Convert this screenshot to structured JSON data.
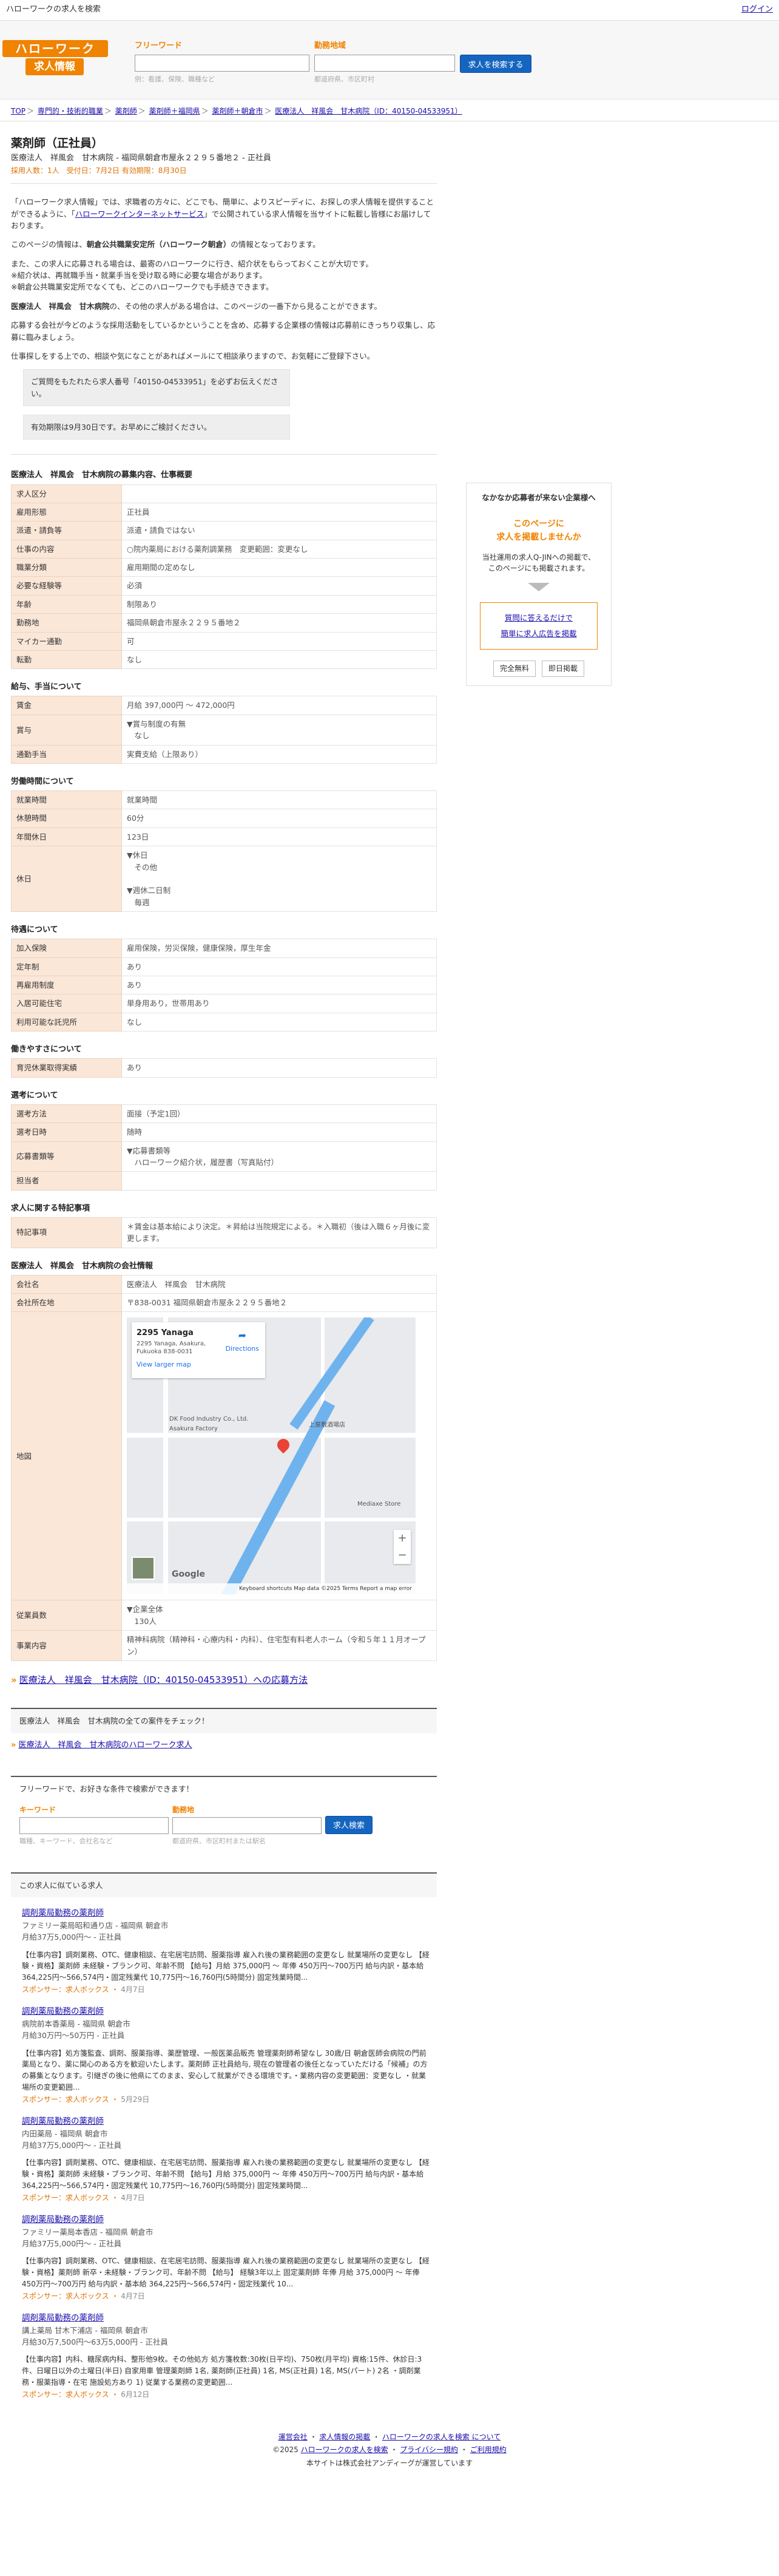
{
  "topbar": {
    "left": "ハローワークの求人を検索",
    "right": "ログイン"
  },
  "logo": {
    "line1": "ハローワーク",
    "line2": "求人情報"
  },
  "search": {
    "keyword_label": "フリーワード",
    "keyword_hint": "例：看護、保険、職種など",
    "area_label": "勤務地域",
    "area_hint": "都道府県、市区町村",
    "button": "求人を検索する"
  },
  "breadcrumb": [
    "TOP",
    "専門的・技術的職業",
    "薬剤師",
    "薬剤師＋福岡県",
    "薬剤師＋朝倉市",
    "医療法人　祥風会　甘木病院（ID：40150-04533951）"
  ],
  "job": {
    "title": "薬剤師（正社員）",
    "sub1": "医療法人　祥風会　甘木病院 - 福岡県朝倉市屋永２２９５番地２ - 正社員",
    "sub2": "採用人数：1人　受付日：7月2日  有効期限：8月30日"
  },
  "intro": {
    "p1a": "「ハローワーク求人情報」では、求職者の方々に、",
    "p1b": "どこでも、簡単に、よりスピーディに、お探しの求人情報を提供することができるように、「",
    "p1link": "ハローワークインターネットサービス",
    "p1c": "」で公開されている求人情報を当サイトに転載し皆様にお届けしております。",
    "p2a": "このページの情報は、",
    "p2b": "朝倉公共職業安定所（ハローワーク朝倉）",
    "p2c": "の情報となっております。",
    "p3": "また、この求人に応募される場合は、最寄のハローワークに行き、紹介状をもらっておくことが大切です。",
    "p4": "※紹介状は、再就職手当・就業手当を受け取る時に必要な場合があります。",
    "p5": "※朝倉公共職業安定所でなくても、どこのハローワークでも手続きできます。",
    "p6a": "医療法人　祥風会　甘木病院",
    "p6b": "の、その他の求人がある場合は、このページの一番下から見ることができます。",
    "p7": "応募する会社が今どのような採用活動をしているかということを含め、応募する企業様の情報は応募前にきっちり収集し、応募に臨みましょう。",
    "p8": "仕事探しをする上での、相談や気になことがあればメールにて相談承りますので、お気軽にご登録下さい。",
    "note1": "ご質問をもたれたら求人番号「40150-04533951」を必ずお伝えください。",
    "note2": "有効期限は9月30日です。お早めにご検討ください。"
  },
  "side": {
    "h": "なかなか応募者が来ない企業様へ",
    "o1": "このページに",
    "o2": "求人を掲載しませんか",
    "t1": "当社運用の求人Q-JINへの掲載で、",
    "t2": "このページにも掲載されます。",
    "b1": "質問に答えるだけで",
    "b2": "簡単に求人広告を掲載",
    "btn1": "完全無料",
    "btn2": "即日掲載"
  },
  "sections": {
    "main_title": "医療法人　祥風会　甘木病院の募集内容、仕事概要",
    "main_rows": [
      [
        "求人区分",
        ""
      ],
      [
        "雇用形態",
        "正社員"
      ],
      [
        "派遣・請負等",
        "派遣・請負ではない"
      ],
      [
        "仕事の内容",
        "○院内薬局における薬剤調業務　変更範囲：変更なし"
      ],
      [
        "職業分類",
        "雇用期間の定めなし"
      ],
      [
        "必要な経験等",
        "必須"
      ],
      [
        "年齢",
        "制限あり"
      ],
      [
        "勤務地",
        "福岡県朝倉市屋永２２９５番地２"
      ],
      [
        "マイカー通勤",
        "可"
      ],
      [
        "転勤",
        "なし"
      ]
    ],
    "pay_title": "給与、手当について",
    "pay_rows": [
      [
        "賃金",
        "月給 397,000円 〜 472,000円"
      ],
      [
        "賞与",
        "▼賞与制度の有無\n　なし"
      ],
      [
        "通勤手当",
        "実費支給（上限あり）"
      ]
    ],
    "time_title": "労働時間について",
    "time_rows": [
      [
        "就業時間",
        "就業時間"
      ],
      [
        "休憩時間",
        "60分"
      ],
      [
        "年間休日",
        "123日"
      ],
      [
        "休日",
        "▼休日\n　その他\n\n▼週休二日制\n　毎週"
      ]
    ],
    "welfare_title": "待遇について",
    "welfare_rows": [
      [
        "加入保険",
        "雇用保険，労災保険，健康保険，厚生年金"
      ],
      [
        "定年制",
        "あり"
      ],
      [
        "再雇用制度",
        "あり"
      ],
      [
        "入居可能住宅",
        "単身用あり，世帯用あり"
      ],
      [
        "利用可能な託児所",
        "なし"
      ]
    ],
    "ease_title": "働きやすさについて",
    "ease_rows": [
      [
        "育児休業取得実績",
        "あり"
      ]
    ],
    "apply_title": "選考について",
    "apply_rows": [
      [
        "選考方法",
        "面接（予定1回）"
      ],
      [
        "選考日時",
        "随時"
      ],
      [
        "応募書類等",
        "▼応募書類等\n　ハローワーク紹介状，履歴書（写真貼付）"
      ],
      [
        "担当者",
        ""
      ]
    ],
    "special_title": "求人に関する特記事項",
    "special_rows": [
      [
        "特記事項",
        "＊賃金は基本給により決定。＊昇給は当院規定による。＊入職初（後は入職６ヶ月後に変更します。"
      ]
    ],
    "company_title": "医療法人　祥風会　甘木病院の会社情報",
    "company_rows": [
      [
        "会社名",
        "医療法人　祥風会　甘木病院"
      ],
      [
        "会社所在地",
        "〒838-0031 福岡県朝倉市屋永２２９５番地２"
      ]
    ],
    "map_label": "地図",
    "company_rows2": [
      [
        "従業員数",
        "▼企業全体\n　130人"
      ],
      [
        "事業内容",
        "精神科病院（精神科・心療内科・内科）、住宅型有料老人ホーム（令和５年１１月オープン）"
      ]
    ]
  },
  "map": {
    "title": "2295 Yanaga",
    "addr": "2295 Yanaga, Asakura, Fukuoka 838-0031",
    "view": "View larger map",
    "dir": "Directions",
    "place1": "DK Food Industry Co., Ltd. Asakura Factory",
    "place2": "上屋敷酒場店",
    "place3": "Mediaxe Store",
    "footer": "Keyboard shortcuts   Map data ©2025   Terms   Report a map error",
    "google": "Google"
  },
  "applylink": "医療法人　祥風会　甘木病院（ID：40150-04533951）への応募方法",
  "allblock": {
    "t": "医療法人　祥風会　甘木病院の全ての案件をチェック！",
    "link": "医療法人　祥風会　甘木病院のハローワーク求人"
  },
  "freesearch": {
    "t": "フリーワードで、お好きな条件で検索ができます！",
    "kw": "キーワード",
    "kwh": "職種、キーワード、会社名など",
    "ar": "勤務地",
    "arh": "都道府県、市区町村または駅名",
    "btn": "求人検索"
  },
  "related_title": "この求人に似ている求人",
  "related": [
    {
      "t": "調剤薬局勤務の薬剤師",
      "m1": "ファミリー薬局昭和通り店 - 福岡県 朝倉市",
      "m2": "月給37万5,000円〜 - 正社員",
      "d": "【仕事内容】調剤業務、OTC、健康相談、在宅居宅訪問、服薬指導 雇入れ後の業務範囲の変更なし 就業場所の変更なし 【経験・資格】薬剤師 未経験・ブランク可、年齢不問 【給与】月給 375,000円 〜 年俸 450万円〜700万円 給与内訳・基本給 364,225円〜566,574円・固定残業代 10,775円〜16,760円(5時間分) 固定残業時間...",
      "sp": "スポンサー：求人ボックス",
      "date": "4月7日"
    },
    {
      "t": "調剤薬局勤務の薬剤師",
      "m1": "病院前本香薬局 - 福岡県 朝倉市",
      "m2": "月給30万円〜50万円 - 正社員",
      "d": "【仕事内容】処方箋監査、調剤、服薬指導、薬歴管理、一般医薬品販売 管理薬剤師希望なし 30歳/日 朝倉医師会病院の門前薬局となり、薬に関心のある方を歓迎いたします。薬剤師 正社員給与, 現在の管理者の後任となっていただける「候補」の方の募集となります。引継ぎの後に他県にてのまま、安心して就業ができる環境です。・業務内容の変更範囲：変更なし ・就業場所の変更範囲...",
      "sp": "スポンサー：求人ボックス",
      "date": "5月29日"
    },
    {
      "t": "調剤薬局勤務の薬剤師",
      "m1": "内田薬局 - 福岡県 朝倉市",
      "m2": "月給37万5,000円〜 - 正社員",
      "d": "【仕事内容】調剤業務、OTC、健康相談、在宅居宅訪問、服薬指導 雇入れ後の業務範囲の変更なし 就業場所の変更なし 【経験・資格】薬剤師 未経験・ブランク可、年齢不問 【給与】月給 375,000円 〜 年俸 450万円〜700万円 給与内訳・基本給 364,225円〜566,574円・固定残業代 10,775円〜16,760円(5時間分) 固定残業時間...",
      "sp": "スポンサー：求人ボックス",
      "date": "4月7日"
    },
    {
      "t": "調剤薬局勤務の薬剤師",
      "m1": "ファミリー薬局本香店 - 福岡県 朝倉市",
      "m2": "月給37万5,000円〜 - 正社員",
      "d": "【仕事内容】調剤業務、OTC、健康相談、在宅居宅訪問、服薬指導 雇入れ後の業務範囲の変更なし 就業場所の変更なし 【経験・資格】薬剤師 新卒・未経験・ブランク可、年齢不問 【給与】 経験3年以上 固定薬剤師 年俸 月給 375,000円 〜 年俸 450万円〜700万円 給与内訳・基本給 364,225円〜566,574円・固定残業代 10...",
      "sp": "スポンサー：求人ボックス",
      "date": "4月7日"
    },
    {
      "t": "調剤薬局勤務の薬剤師",
      "m1": "講上薬局 甘木下浦店 - 福岡県 朝倉市",
      "m2": "月給30万7,500円〜63万5,000円 - 正社員",
      "d": "【仕事内容】内科、糖尿病内科、整形他9枚。その他処方 処方箋枚数:30枚(日平均)、750枚(月平均) 資格:15件、休診日:3件、日曜日以外の土曜日(半日) 自家用車 管理薬剤師 1名, 薬剤師(正社員) 1名, MS(正社員) 1名, MS(パート) 2名 ・調剤業務・服薬指導・在宅 施設処方あり 1) 従業する業務の変更範囲...",
      "sp": "スポンサー：求人ボックス",
      "date": "6月12日"
    }
  ],
  "footer": {
    "l1a": "運営会社",
    "l1b": "求人情報の掲載",
    "l1c": "ハローワークの求人を検索 について",
    "l2a": "©2025",
    "l2b": "ハローワークの求人を検索",
    "l2c": "プライバシー規約",
    "l2d": "ご利用規約",
    "l3": "本サイトは株式会社アンディーグが運営しています"
  }
}
